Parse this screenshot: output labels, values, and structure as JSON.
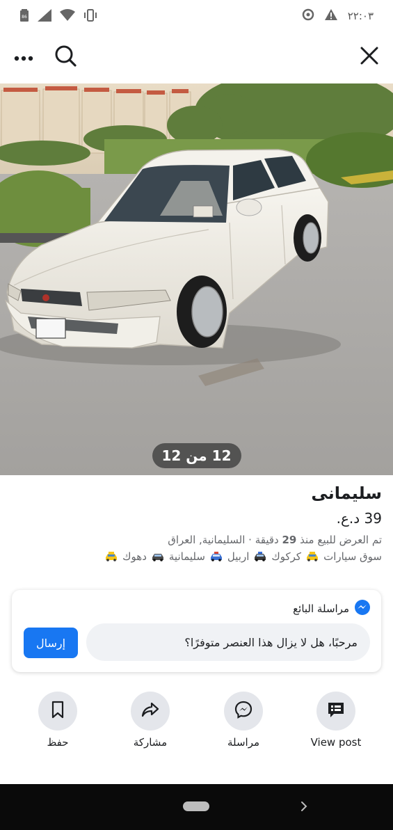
{
  "status_bar": {
    "time": "٢٢:٠٣",
    "battery_level": "86",
    "icons": [
      "battery-icon",
      "signal-icon",
      "wifi-icon",
      "vibrate-icon",
      "data-saver-icon",
      "warning-icon"
    ]
  },
  "nav": {
    "icons": [
      "more-icon",
      "search-icon",
      "close-icon"
    ]
  },
  "photo": {
    "counter": "12 من 12"
  },
  "listing": {
    "title": "سليمانى",
    "price": "39 د.ع.",
    "meta_prefix": "تم العرض للبيع منذ",
    "meta_minutes": "29",
    "meta_suffix": "دقيقة · السليمانية, العراق",
    "tags": [
      "سوق سيارات",
      "كركوك",
      "اربيل",
      "سليمانية",
      "دهوك"
    ]
  },
  "message": {
    "header_label": "مراسلة البائع",
    "input_value": "مرحبًا، هل لا يزال هذا العنصر متوفرًا؟",
    "send_label": "إرسال"
  },
  "actions": [
    {
      "label": "View post",
      "icon": "view-post-icon"
    },
    {
      "label": "مراسلة",
      "icon": "messenger-icon"
    },
    {
      "label": "مشاركة",
      "icon": "share-icon"
    },
    {
      "label": "حفظ",
      "icon": "bookmark-icon"
    }
  ],
  "colors": {
    "accent": "#1877f2",
    "secondary_text": "#65676b",
    "button_bg": "#e4e6eb",
    "input_bg": "#f0f2f5",
    "taxi_yellow": "#f5c518"
  }
}
